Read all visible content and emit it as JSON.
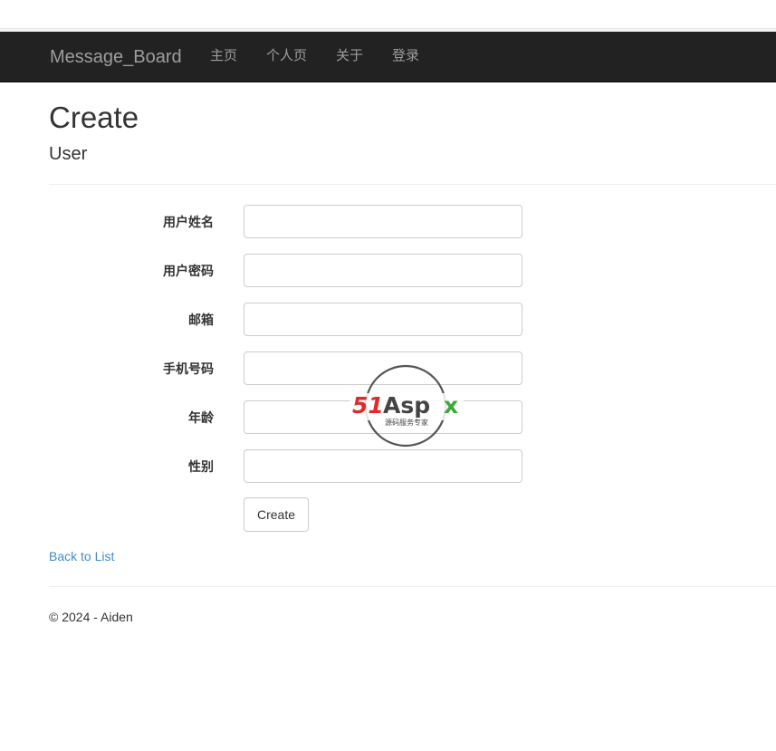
{
  "nav": {
    "brand": "Message_Board",
    "links": [
      "主页",
      "个人页",
      "关于",
      "登录"
    ]
  },
  "page": {
    "title": "Create",
    "subtitle": "User"
  },
  "form": {
    "fields": [
      {
        "label": "用户姓名",
        "value": ""
      },
      {
        "label": "用户密码",
        "value": ""
      },
      {
        "label": "邮箱",
        "value": ""
      },
      {
        "label": "手机号码",
        "value": ""
      },
      {
        "label": "年龄",
        "value": ""
      },
      {
        "label": "性别",
        "value": ""
      }
    ],
    "submit_label": "Create"
  },
  "back_link": "Back to List",
  "footer": "© 2024 - Aiden",
  "watermark": {
    "text_red": "51",
    "text_dark": "Asp",
    "text_green": "x",
    "tagline": "源码服务专家"
  },
  "colors": {
    "navbar_bg": "#222222",
    "nav_text": "#9d9d9d",
    "link": "#428bca",
    "watermark_red": "#e02b2b",
    "watermark_green": "#3aa83a"
  }
}
